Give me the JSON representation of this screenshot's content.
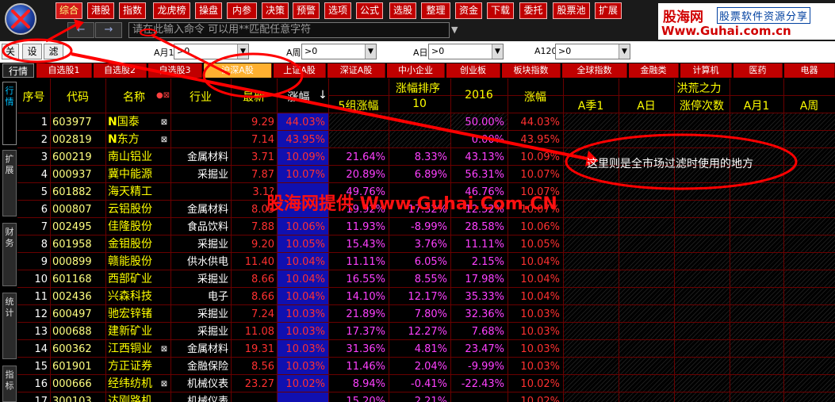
{
  "menu": [
    "综合",
    "港股",
    "指数",
    "龙虎榜",
    "操盘",
    "内参",
    "决策",
    "预警",
    "选项",
    "公式",
    "选股",
    "整理",
    "资金",
    "下载",
    "委托",
    "股票池",
    "扩展"
  ],
  "brand": {
    "name": "股海网",
    "slogan": "股票软件资源分享",
    "url": "Www.Guhai.com.cn"
  },
  "command": {
    "placeholder": "请在此输入命令    可以用**匹配任意字符"
  },
  "nav": {
    "back": "←",
    "forward": "→"
  },
  "filter": {
    "btns": [
      "关",
      "设",
      "滤"
    ],
    "fields": [
      {
        "label": "A月1",
        "value": ">0"
      },
      {
        "label": "A周",
        "value": ">0"
      },
      {
        "label": "A日",
        "value": ">0"
      },
      {
        "label": "A120",
        "value": ">0"
      }
    ]
  },
  "tabs": [
    "行情",
    "自选股1",
    "自选股2",
    "自选股3",
    "沪深A股",
    "上证A股",
    "深证A股",
    "中小企业",
    "创业板",
    "板块指数",
    "全球指数",
    "金融类",
    "计算机",
    "医药",
    "电器"
  ],
  "side_tabs": [
    "行情",
    "扩展",
    "财务",
    "统计",
    "指标"
  ],
  "headers": {
    "seq": "序号",
    "code": "代码",
    "name": "名称",
    "industry": "行业",
    "latest": "最新",
    "change": "涨幅",
    "sort_arrow": "↓",
    "rank_group": "涨幅排序",
    "rank_sub": "5组涨幅",
    "rank_10": "10",
    "y2016": "2016",
    "change2": "涨幅",
    "right_group": "洪荒之力",
    "aq": "A季1",
    "ad": "A日",
    "limit": "涨停次数",
    "am": "A月1",
    "aw": "A周"
  },
  "rows": [
    {
      "seq": "1",
      "code": "603977",
      "name_n": "N",
      "name": "国泰",
      "mark": "⊠",
      "industry": "",
      "latest": "9.29",
      "change": "44.03%",
      "g5": "",
      "r10": "",
      "y2016": "50.00%",
      "c2": "44.03%"
    },
    {
      "seq": "2",
      "code": "002819",
      "name_n": "N",
      "name": "东方",
      "mark": "⊠",
      "industry": "",
      "latest": "7.14",
      "change": "43.95%",
      "g5": "",
      "r10": "",
      "y2016": "0.00%",
      "c2": "43.95%"
    },
    {
      "seq": "3",
      "code": "600219",
      "name_n": "",
      "name": "南山铝业",
      "mark": "",
      "industry": "金属材料",
      "latest": "3.71",
      "change": "10.09%",
      "g5": "21.64%",
      "r10": "8.33%",
      "y2016": "43.13%",
      "c2": "10.09%"
    },
    {
      "seq": "4",
      "code": "000937",
      "name_n": "",
      "name": "冀中能源",
      "mark": "",
      "industry": "采掘业",
      "latest": "7.87",
      "change": "10.07%",
      "g5": "20.89%",
      "r10": "6.89%",
      "y2016": "56.31%",
      "c2": "10.07%"
    },
    {
      "seq": "5",
      "code": "601882",
      "name_n": "",
      "name": "海天精工",
      "mark": "",
      "industry": "",
      "latest": "3.1?",
      "change": "",
      "g5": "49.76%",
      "r10": "",
      "y2016": "46.76%",
      "c2": "10.07%"
    },
    {
      "seq": "6",
      "code": "000807",
      "name_n": "",
      "name": "云铝股份",
      "mark": "",
      "industry": "金属材料",
      "latest": "8.03",
      "change": "",
      "g5": "19.92%",
      "r10": "17.32%",
      "y2016": "12.52%",
      "c2": "10.07%"
    },
    {
      "seq": "7",
      "code": "002495",
      "name_n": "",
      "name": "佳隆股份",
      "mark": "",
      "industry": "食品饮料",
      "latest": "7.88",
      "change": "10.06%",
      "g5": "11.93%",
      "r10": "-8.99%",
      "y2016": "28.58%",
      "c2": "10.06%"
    },
    {
      "seq": "8",
      "code": "601958",
      "name_n": "",
      "name": "金钼股份",
      "mark": "",
      "industry": "采掘业",
      "latest": "9.20",
      "change": "10.05%",
      "g5": "15.43%",
      "r10": "3.76%",
      "y2016": "11.11%",
      "c2": "10.05%"
    },
    {
      "seq": "9",
      "code": "000899",
      "name_n": "",
      "name": "赣能股份",
      "mark": "",
      "industry": "供水供电",
      "latest": "11.40",
      "change": "10.04%",
      "g5": "11.11%",
      "r10": "6.05%",
      "y2016": "2.15%",
      "c2": "10.04%"
    },
    {
      "seq": "10",
      "code": "601168",
      "name_n": "",
      "name": "西部矿业",
      "mark": "",
      "industry": "采掘业",
      "latest": "8.66",
      "change": "10.04%",
      "g5": "16.55%",
      "r10": "8.55%",
      "y2016": "17.98%",
      "c2": "10.04%"
    },
    {
      "seq": "11",
      "code": "002436",
      "name_n": "",
      "name": "兴森科技",
      "mark": "",
      "industry": "电子",
      "latest": "8.66",
      "change": "10.04%",
      "g5": "14.10%",
      "r10": "12.17%",
      "y2016": "35.33%",
      "c2": "10.04%"
    },
    {
      "seq": "12",
      "code": "600497",
      "name_n": "",
      "name": "驰宏锌锗",
      "mark": "",
      "industry": "采掘业",
      "latest": "7.24",
      "change": "10.03%",
      "g5": "21.89%",
      "r10": "7.80%",
      "y2016": "32.36%",
      "c2": "10.03%"
    },
    {
      "seq": "13",
      "code": "000688",
      "name_n": "",
      "name": "建新矿业",
      "mark": "",
      "industry": "采掘业",
      "latest": "11.08",
      "change": "10.03%",
      "g5": "17.37%",
      "r10": "12.27%",
      "y2016": "7.68%",
      "c2": "10.03%"
    },
    {
      "seq": "14",
      "code": "600362",
      "name_n": "",
      "name": "江西铜业",
      "mark": "⊠",
      "industry": "金属材料",
      "latest": "19.31",
      "change": "10.03%",
      "g5": "31.36%",
      "r10": "4.81%",
      "y2016": "23.47%",
      "c2": "10.03%"
    },
    {
      "seq": "15",
      "code": "601901",
      "name_n": "",
      "name": "方正证券",
      "mark": "",
      "industry": "金融保险",
      "latest": "8.56",
      "change": "10.03%",
      "g5": "11.46%",
      "r10": "2.04%",
      "y2016": "-9.99%",
      "c2": "10.03%"
    },
    {
      "seq": "16",
      "code": "000666",
      "name_n": "",
      "name": "经纬纺机",
      "mark": "⊠",
      "industry": "机械仪表",
      "latest": "23.27",
      "change": "10.02%",
      "g5": "8.94%",
      "r10": "-0.41%",
      "y2016": "-22.43%",
      "c2": "10.02%"
    },
    {
      "seq": "17",
      "code": "300103",
      "name_n": "",
      "name": "达刚路机",
      "mark": "",
      "industry": "机械仪表",
      "latest": "",
      "change": "",
      "g5": "15.20%",
      "r10": "2.21%",
      "y2016": "",
      "c2": "10.02%"
    }
  ],
  "annotation": {
    "text": "这里则是全市场过滤时使用的地方"
  },
  "watermark": "股海网提供 Www.Guhai.Com.CN",
  "colors": {
    "up": "#ff3030",
    "code": "#ffff80",
    "name": "#ffff00",
    "industry": "#ffffff",
    "magenta": "#ff40ff",
    "ellipse": "#ff0000",
    "blue": "#1010b0"
  }
}
